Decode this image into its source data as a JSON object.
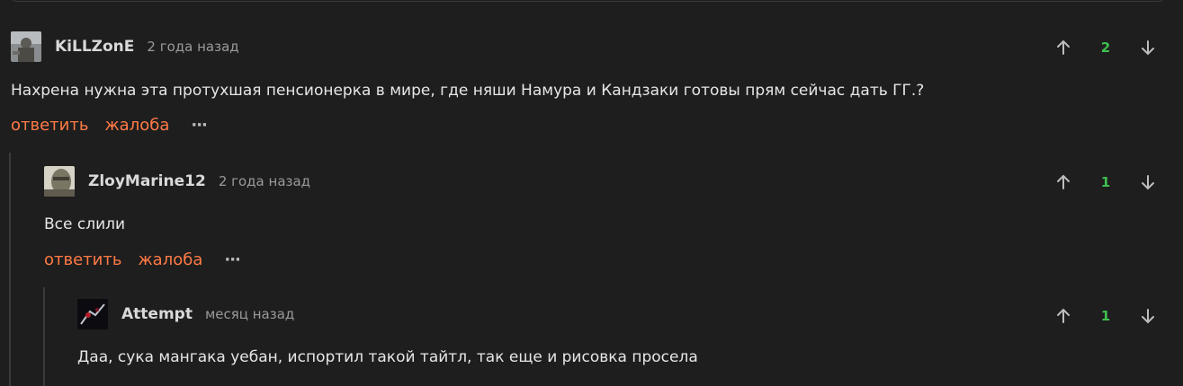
{
  "comments": [
    {
      "username": "KiLLZonE",
      "time": "2 года назад",
      "text": "Нахрена нужна эта протухшая пенсионерка в мире, где няши Намура и Кандзаки готовы прям сейчас дать ГГ.?",
      "score": "2",
      "reply_label": "ответить",
      "report_label": "жалоба",
      "more_label": "···"
    },
    {
      "username": "ZloyMarine12",
      "time": "2 года назад",
      "text": "Все слили",
      "score": "1",
      "reply_label": "ответить",
      "report_label": "жалоба",
      "more_label": "···"
    },
    {
      "username": "Attempt",
      "time": "месяц назад",
      "text": "Даа, сука мангака уебан, испортил такой тайтл, так еще и рисовка просела",
      "score": "1"
    }
  ],
  "colors": {
    "background": "#1e1e1e",
    "action": "#ff7a45",
    "score": "#3fbf4f",
    "thread_line": "#3a3a3a"
  },
  "icons": [
    "arrow-up-icon",
    "arrow-down-icon",
    "more-icon"
  ]
}
